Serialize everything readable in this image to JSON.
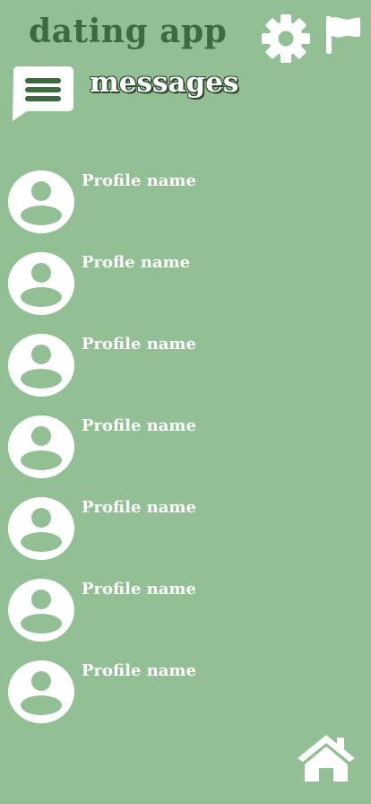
{
  "header": {
    "app_title": "dating app",
    "settings_icon": "gear-icon",
    "report_icon": "flag-icon"
  },
  "section": {
    "icon": "chat-bubble-icon",
    "title": "messages"
  },
  "conversations": [
    {
      "name": "Profile name",
      "avatar_icon": "user-avatar-icon"
    },
    {
      "name": "Profle name",
      "avatar_icon": "user-avatar-icon"
    },
    {
      "name": "Profile name",
      "avatar_icon": "user-avatar-icon"
    },
    {
      "name": "Profile name",
      "avatar_icon": "user-avatar-icon"
    },
    {
      "name": "Profile name",
      "avatar_icon": "user-avatar-icon"
    },
    {
      "name": "Profile name",
      "avatar_icon": "user-avatar-icon"
    },
    {
      "name": "Profile name",
      "avatar_icon": "user-avatar-icon"
    }
  ],
  "footer": {
    "home_icon": "home-icon"
  },
  "colors": {
    "background": "#93bf95",
    "title": "#3d6b40",
    "foreground": "#ffffff"
  }
}
